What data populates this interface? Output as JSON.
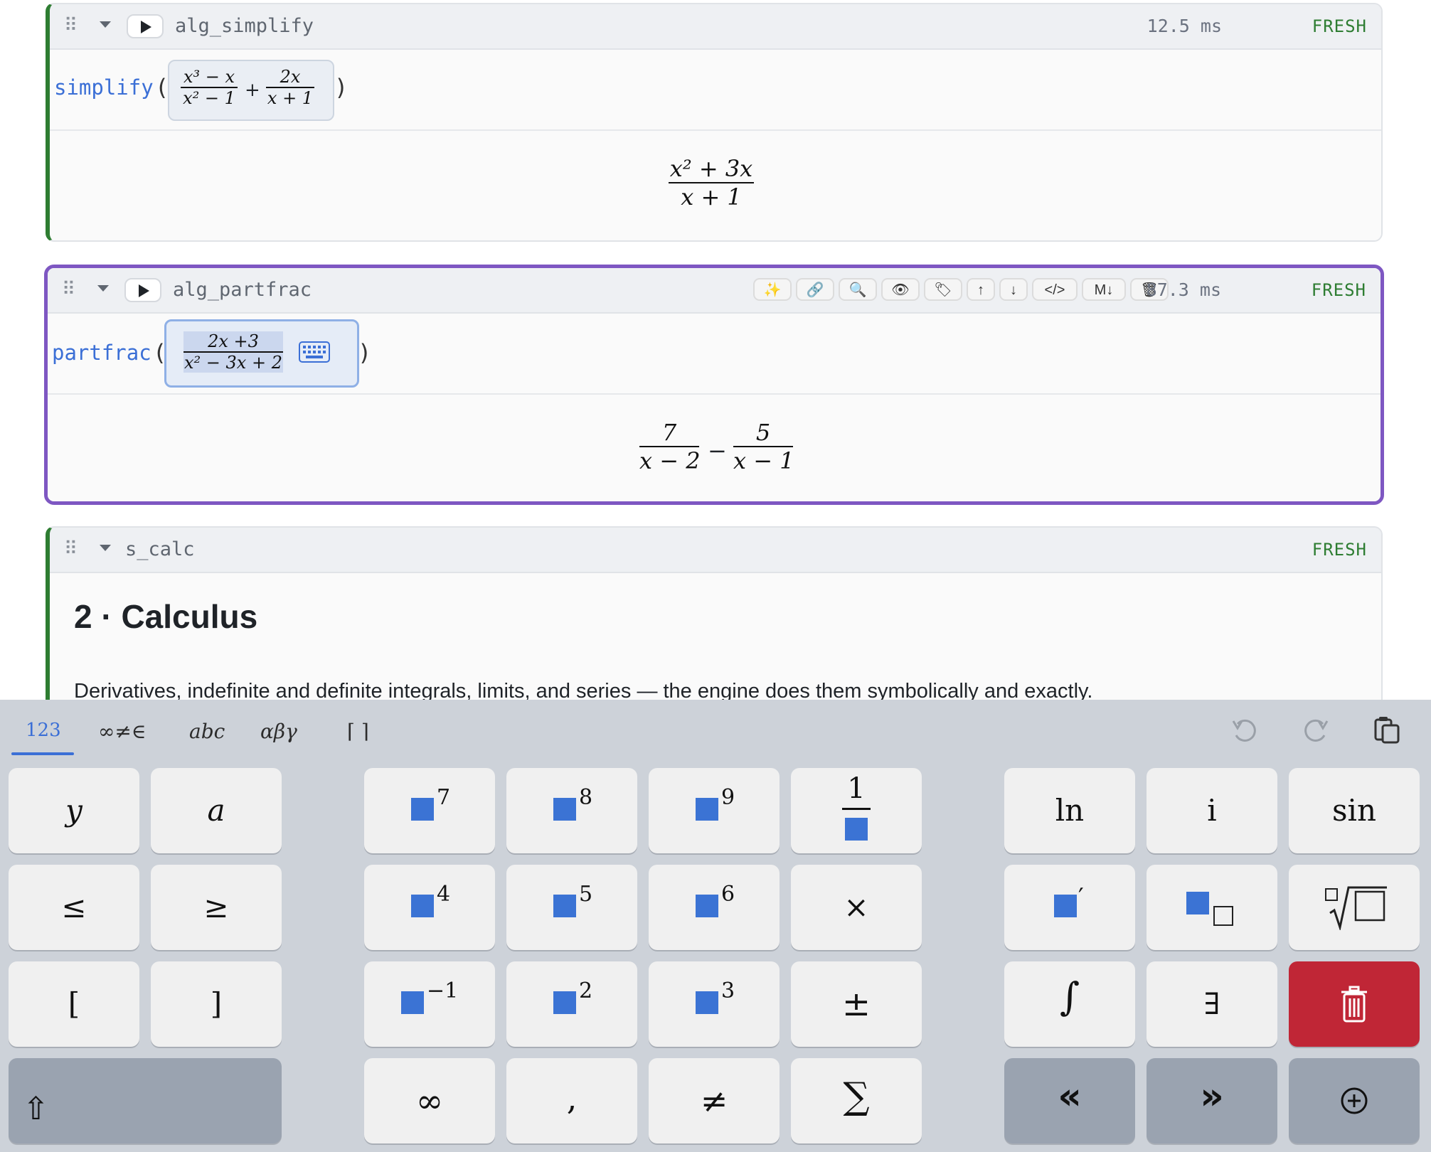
{
  "cells": [
    {
      "name": "alg_simplify",
      "timing": "12.5 ms",
      "status": "FRESH",
      "func": "simplify",
      "open_paren": "(",
      "close_paren": ")",
      "input": {
        "term1_num": "x³ − x",
        "term1_den": "x² − 1",
        "op": "+",
        "term2_num": "2x",
        "term2_den": "x + 1"
      },
      "output": {
        "num": "x² + 3x",
        "den": "x + 1"
      }
    },
    {
      "name": "alg_partfrac",
      "timing": "87.3 ms",
      "status": "FRESH",
      "func": "partfrac",
      "open_paren": "(",
      "close_paren": ")",
      "input": {
        "num": "2x +3",
        "den": "x² − 3x + 2"
      },
      "output": {
        "t1_num": "7",
        "t1_den": "x − 2",
        "op": "−",
        "t2_num": "5",
        "t2_den": "x − 1"
      },
      "toolbar": [
        "✨",
        "🔗",
        "🔍",
        "👁",
        "🏷",
        "↑",
        "↓",
        "</>",
        "M↓",
        "🗑"
      ]
    },
    {
      "name": "s_calc",
      "status": "FRESH",
      "heading": "2 · Calculus",
      "paragraph": "Derivatives, indefinite and definite integrals, limits, and series — the engine does them symbolically and exactly."
    }
  ],
  "keyboard": {
    "tabs": [
      "123",
      "∞≠∈",
      "abc",
      "αβγ",
      "⌈ ⌉"
    ],
    "selected_tab": "123",
    "left": [
      [
        "y",
        "a"
      ],
      [
        "≤",
        "≥"
      ],
      [
        "[",
        "]"
      ]
    ],
    "shift_label": "⇧",
    "num_powers": [
      [
        "7",
        "8",
        "9"
      ],
      [
        "4",
        "5",
        "6"
      ],
      [
        "−1",
        "2",
        "3"
      ]
    ],
    "num_right": [
      "1",
      "×",
      "±",
      "∑"
    ],
    "num_bottom": [
      "∞",
      ",",
      "≠"
    ],
    "right": [
      [
        "ln",
        "i",
        "sin"
      ],
      [
        "′",
        "",
        ""
      ],
      [
        "∫",
        "∃",
        ""
      ]
    ],
    "nav": [
      "«",
      "»"
    ],
    "colors": {
      "accent": "#3b73d4",
      "delete": "#c02636",
      "fresh": "#2e7d32",
      "focus_border": "#7e57c2"
    }
  }
}
